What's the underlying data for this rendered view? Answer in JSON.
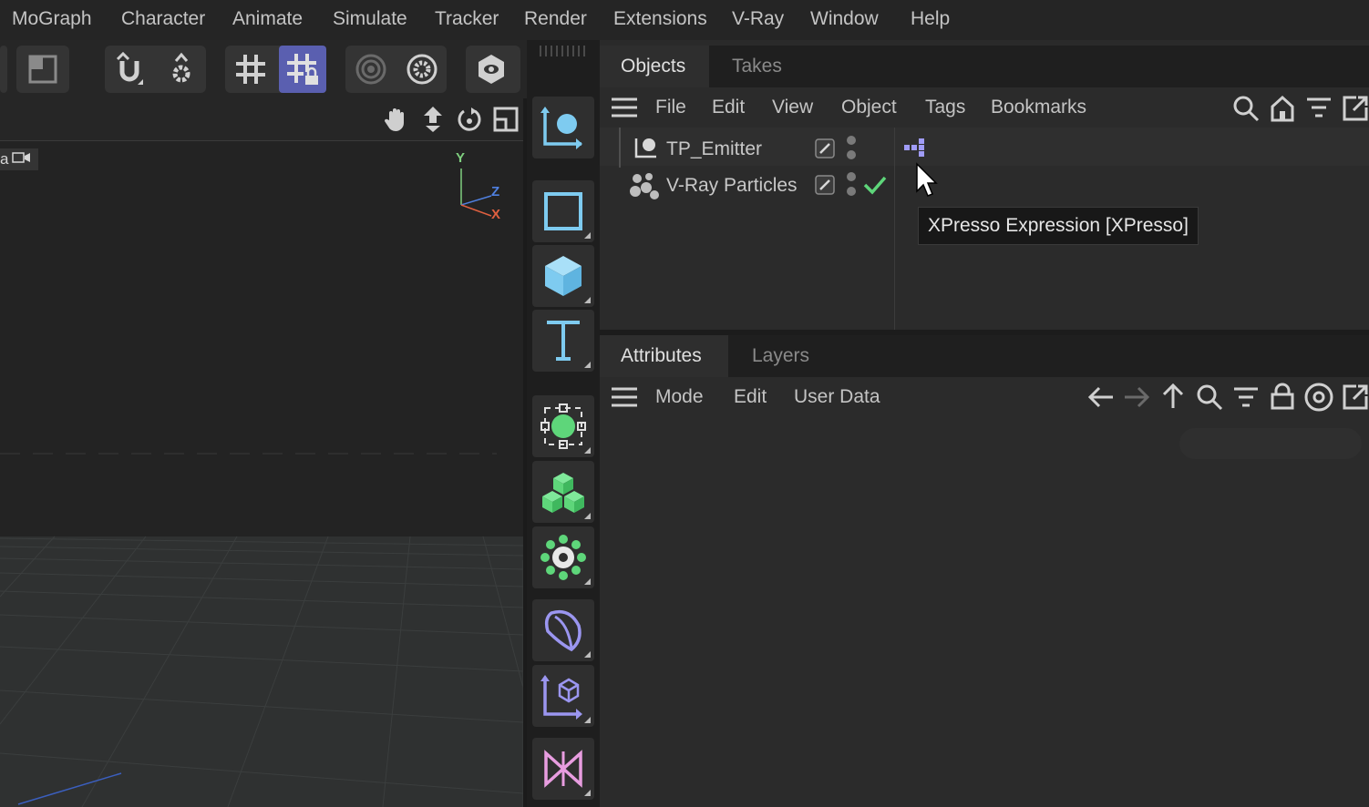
{
  "menu": [
    "MoGraph",
    "Character",
    "Animate",
    "Simulate",
    "Tracker",
    "Render",
    "Extensions",
    "V-Ray",
    "Window",
    "Help"
  ],
  "toolbar": {
    "icons": [
      "model-mode-icon",
      "snap-magnet-icon",
      "snap-settings-icon",
      "grid-icon",
      "grid-lock-icon",
      "render-region-icon",
      "render-settings-icon",
      "view-eye-icon"
    ]
  },
  "viewport": {
    "nav_icons": [
      "pan-hand-icon",
      "move-vertical-icon",
      "rotate-icon",
      "maximize-icon"
    ],
    "camera_label": "a",
    "axis": {
      "y": "Y",
      "z": "Z",
      "x": "X"
    }
  },
  "palette": {
    "tools": [
      "live-selection-icon",
      "rectangle-icon",
      "cube-icon",
      "text-icon",
      "generator-icon",
      "cloner-icon",
      "effector-icon",
      "deformer-icon",
      "null-object-icon",
      "camera-icon"
    ]
  },
  "objects_panel": {
    "tabs": [
      "Objects",
      "Takes"
    ],
    "active_tab": "Objects",
    "menu": [
      "File",
      "Edit",
      "View",
      "Object",
      "Tags",
      "Bookmarks"
    ],
    "header_icons": [
      "search-icon",
      "home-icon",
      "filter-icon",
      "popout-icon"
    ],
    "objects": [
      {
        "name": "TP_Emitter"
      },
      {
        "name": "V-Ray Particles"
      }
    ],
    "tooltip": "XPresso Expression [XPresso]"
  },
  "attributes_panel": {
    "tabs": [
      "Attributes",
      "Layers"
    ],
    "active_tab": "Attributes",
    "menu": [
      "Mode",
      "Edit",
      "User Data"
    ],
    "header_icons": [
      "back-arrow-icon",
      "forward-arrow-icon",
      "up-arrow-icon",
      "search-icon",
      "filter-icon",
      "lock-icon",
      "target-icon",
      "popout-icon"
    ]
  },
  "colors": {
    "accent_blue": "#7ecbf0",
    "accent_green": "#5ed67a",
    "accent_purple": "#9b96f0",
    "accent_pink": "#e89de0",
    "active_toggle": "#5a5fb0"
  }
}
